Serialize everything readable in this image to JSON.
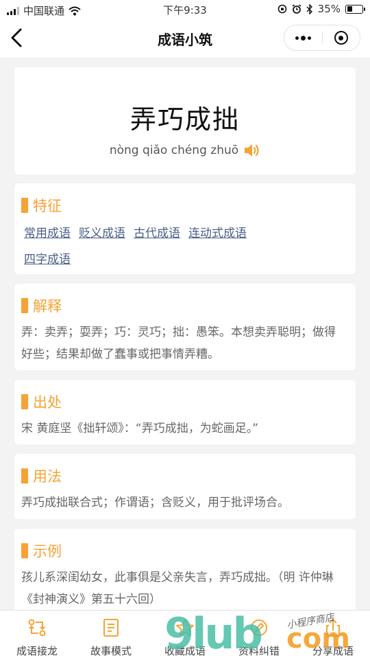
{
  "status_bar": {
    "carrier": "中国联通",
    "time": "下午9:33",
    "battery": "35%",
    "battery_level_percent": 35
  },
  "nav": {
    "title": "成语小筑"
  },
  "idiom": {
    "word": "弄巧成拙",
    "pinyin": "nòng qiǎo chéng zhuō"
  },
  "features": {
    "title": "特征",
    "tags": [
      "常用成语",
      "贬义成语",
      "古代成语",
      "连动式成语",
      "四字成语"
    ]
  },
  "explanation": {
    "title": "解释",
    "text": "弄：卖弄；耍弄；巧：灵巧；拙：愚笨。本想卖弄聪明；做得好些；结果却做了蠢事或把事情弄糟。"
  },
  "source": {
    "title": "出处",
    "text": "宋 黄庭坚《拙轩颂》：“弄巧成拙，为蛇画足。”"
  },
  "usage": {
    "title": "用法",
    "text": "弄巧成拙联合式；作谓语；含贬义，用于批评场合。"
  },
  "example": {
    "title": "示例",
    "text": "孩儿系深闺幼女，此事俱是父亲失言，弄巧成拙。（明 许仲琳《封神演义》第五十六回）"
  },
  "tab_bar": {
    "items": [
      {
        "label": "成语接龙",
        "icon": "swap-icon"
      },
      {
        "label": "故事模式",
        "icon": "book-icon"
      },
      {
        "label": "收藏成语",
        "icon": "star-icon"
      },
      {
        "label": "资料纠错",
        "icon": "edit-icon"
      },
      {
        "label": "分享成语",
        "icon": "share-icon"
      }
    ]
  },
  "watermark": {
    "main": "9lub",
    "suffix": "com",
    "small": "小程序商店"
  },
  "colors": {
    "accent": "#f7a235",
    "tag_link": "#4a5f87",
    "background": "#f3f3f3"
  }
}
